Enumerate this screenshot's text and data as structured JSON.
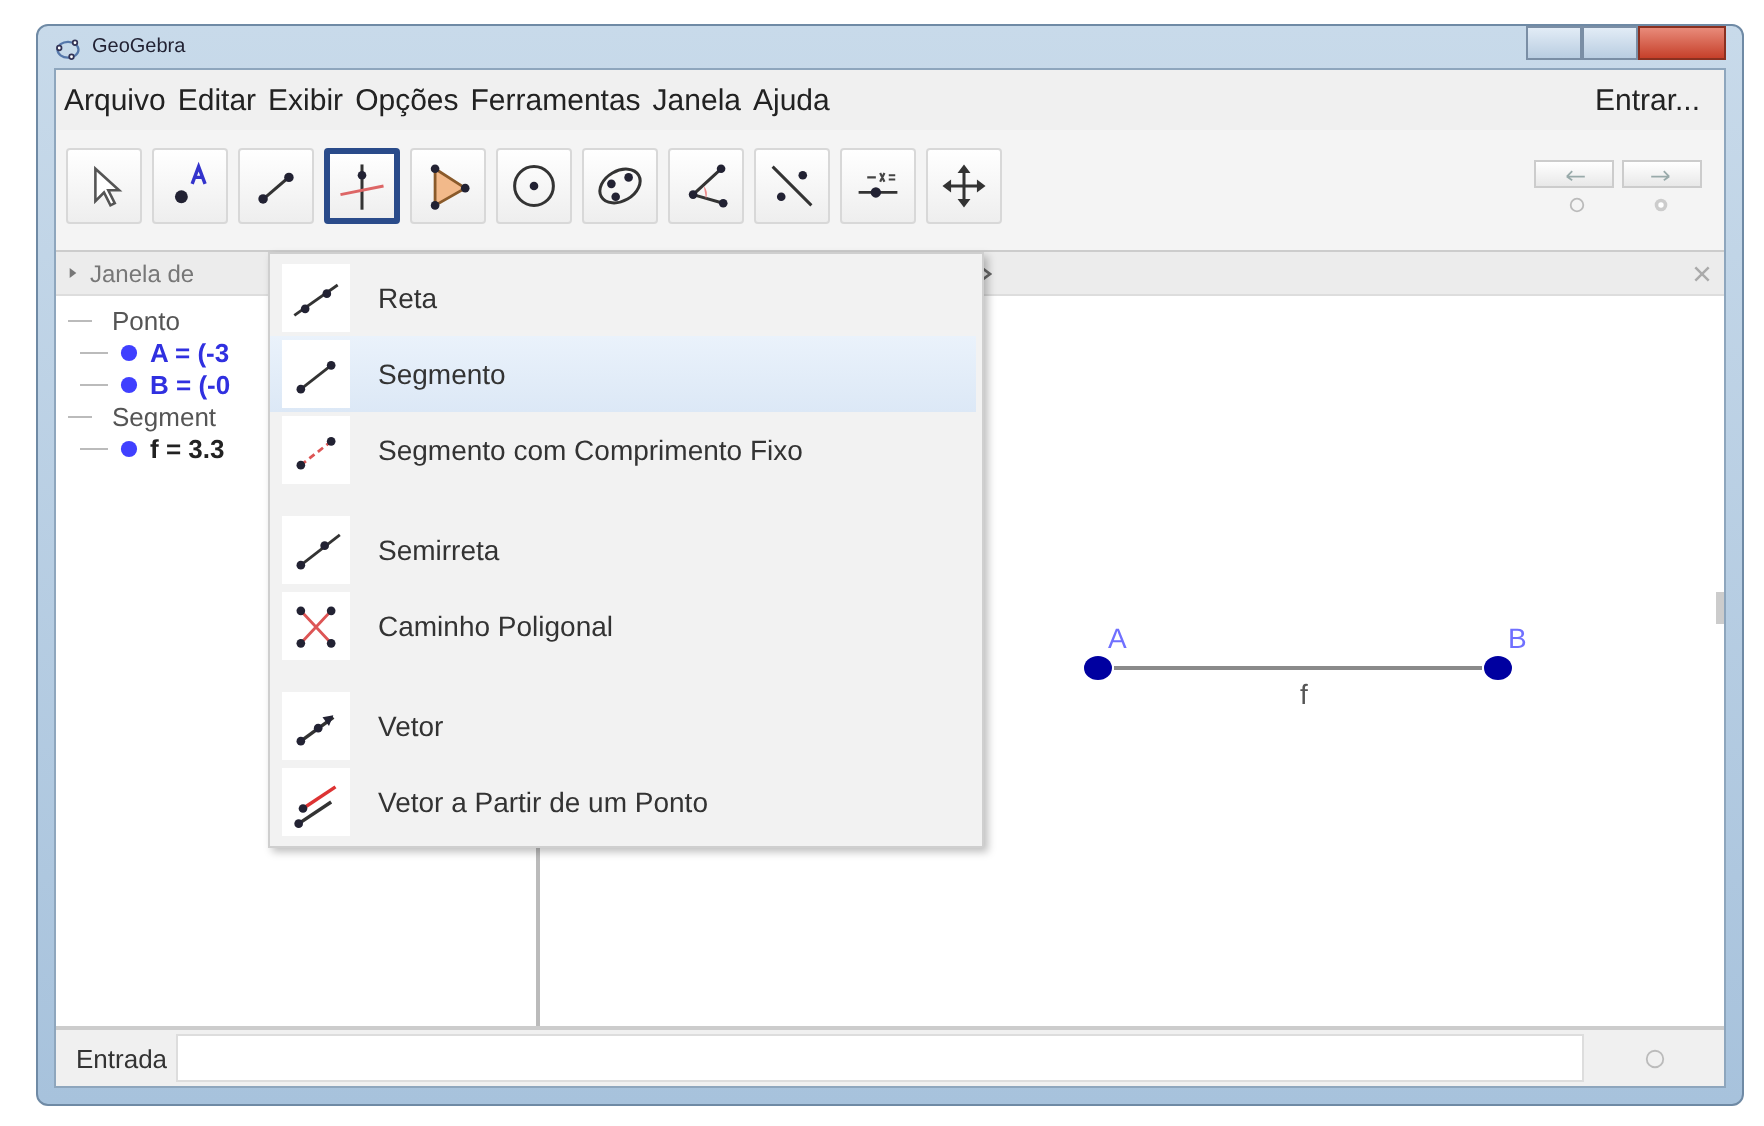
{
  "window": {
    "title": "GeoGebra"
  },
  "menu_bar": {
    "items": [
      "Arquivo",
      "Editar",
      "Exibir",
      "Opções",
      "Ferramentas",
      "Janela",
      "Ajuda"
    ],
    "login": "Entrar..."
  },
  "toolbar": {
    "tools": [
      {
        "selected": false
      },
      {
        "selected": false
      },
      {
        "selected": false
      },
      {
        "selected": true
      },
      {
        "selected": false
      },
      {
        "selected": false
      },
      {
        "selected": false
      },
      {
        "selected": false
      },
      {
        "selected": false
      },
      {
        "selected": false
      },
      {
        "selected": false
      }
    ]
  },
  "algebra_view": {
    "title": "Janela de",
    "groups": [
      {
        "name": "Ponto",
        "items": [
          "A = (-3",
          "B = (-0"
        ]
      },
      {
        "name": "Segment",
        "items": [
          "f = 3.3"
        ]
      }
    ]
  },
  "tool_menu": {
    "groups": [
      [
        {
          "label": "Reta",
          "selected": false
        },
        {
          "label": "Segmento",
          "selected": true
        },
        {
          "label": "Segmento com Comprimento Fixo",
          "selected": false
        }
      ],
      [
        {
          "label": "Semirreta",
          "selected": false
        },
        {
          "label": "Caminho Poligonal",
          "selected": false
        }
      ],
      [
        {
          "label": "Vetor",
          "selected": false
        },
        {
          "label": "Vetor a Partir de um Ponto",
          "selected": false
        }
      ]
    ]
  },
  "graphics_view": {
    "points": [
      {
        "label": "A"
      },
      {
        "label": "B"
      }
    ],
    "segment": {
      "label": "f"
    }
  },
  "input_bar": {
    "label": "Entrada"
  }
}
